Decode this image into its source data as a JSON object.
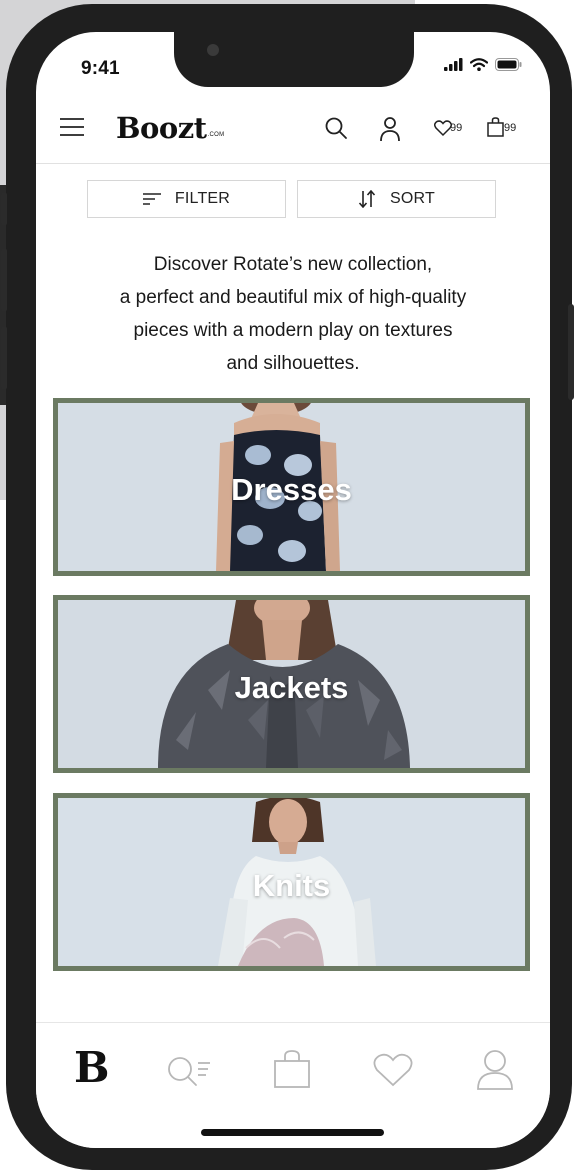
{
  "status": {
    "time": "9:41"
  },
  "header": {
    "logo": "Boozt",
    "logo_suffix": ".COM",
    "wishlist_count": "99",
    "bag_count": "99"
  },
  "toolbar": {
    "filter_label": "FILTER",
    "sort_label": "SORT"
  },
  "intro": {
    "lines": [
      "Discover Rotate’s new collection,",
      "a perfect and beautiful mix of high-quality",
      "pieces with a modern play on textures",
      "and silhouettes."
    ]
  },
  "categories": [
    {
      "label": "Dresses"
    },
    {
      "label": "Jackets"
    },
    {
      "label": "Knits"
    }
  ],
  "tabbar": {
    "home_logo": "B"
  },
  "colors": {
    "category_border": "#6b7a62",
    "phone_frame": "#1f1f1f",
    "tile_background": "#d3dbe3"
  }
}
